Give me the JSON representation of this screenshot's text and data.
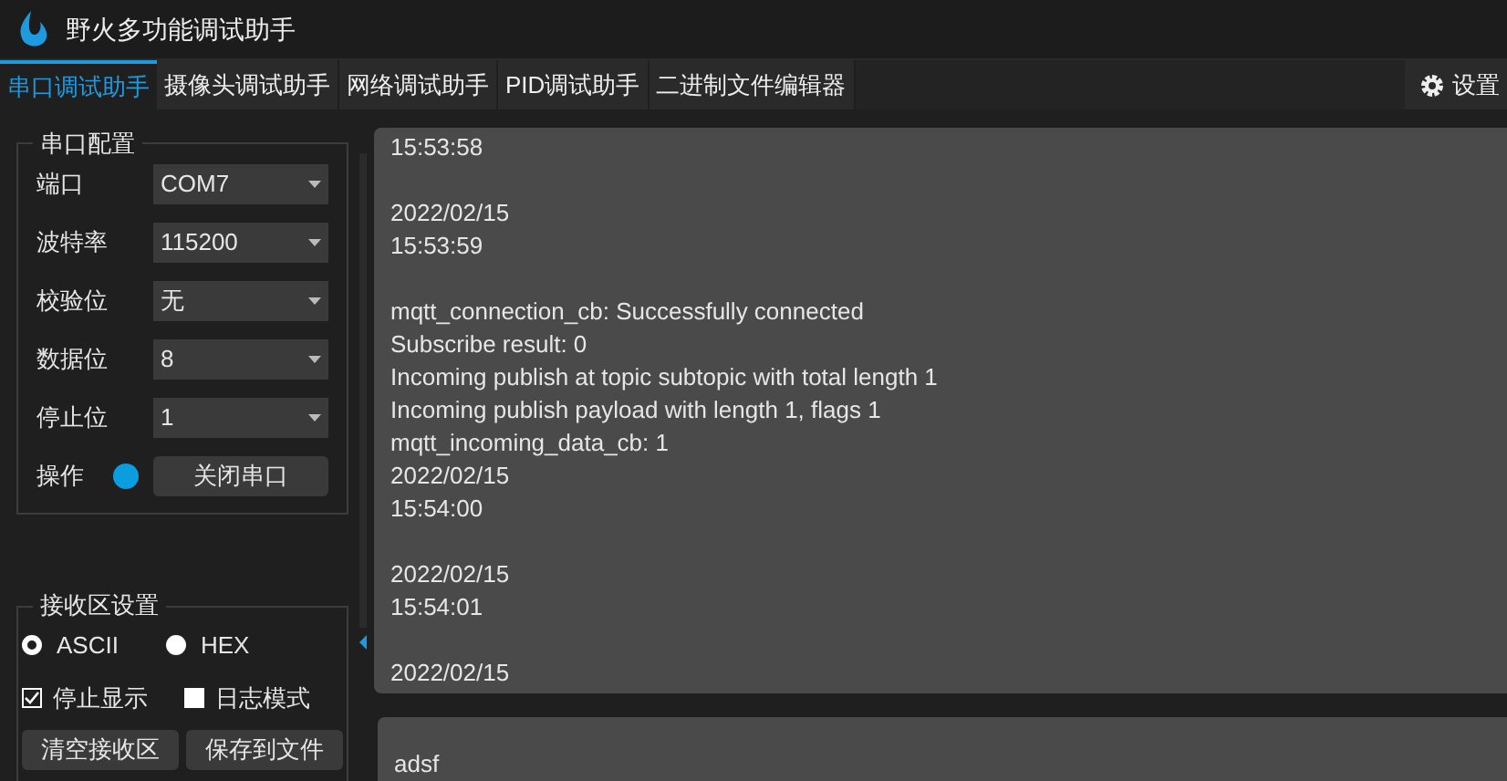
{
  "window": {
    "title": "野火多功能调试助手"
  },
  "tabs": [
    {
      "label": "串口调试助手",
      "selected": true
    },
    {
      "label": "摄像头调试助手",
      "selected": false
    },
    {
      "label": "网络调试助手",
      "selected": false
    },
    {
      "label": "PID调试助手",
      "selected": false
    },
    {
      "label": "二进制文件编辑器",
      "selected": false
    }
  ],
  "settings_button": {
    "label": "设置"
  },
  "serial_config": {
    "title": "串口配置",
    "fields": [
      {
        "label": "端口",
        "value": "COM7"
      },
      {
        "label": "波特率",
        "value": "115200"
      },
      {
        "label": "校验位",
        "value": "无"
      },
      {
        "label": "数据位",
        "value": "8"
      },
      {
        "label": "停止位",
        "value": "1"
      }
    ],
    "operation": {
      "label": "操作",
      "connected": true,
      "button": "关闭串口"
    }
  },
  "receive_settings": {
    "title": "接收区设置",
    "modes": [
      {
        "label": "ASCII",
        "selected": true
      },
      {
        "label": "HEX",
        "selected": false
      }
    ],
    "options": [
      {
        "label": "停止显示",
        "checked": true
      },
      {
        "label": "日志模式",
        "checked": false
      }
    ],
    "buttons": [
      "清空接收区",
      "保存到文件"
    ]
  },
  "receive_log": [
    [
      "15:53:58"
    ],
    [
      "2022/02/15",
      "15:53:59"
    ],
    [
      "mqtt_connection_cb: Successfully connected",
      "Subscribe result: 0",
      "Incoming publish at topic subtopic with total length 1",
      "Incoming publish payload with length 1, flags 1",
      "mqtt_incoming_data_cb: 1",
      "2022/02/15",
      "15:54:00"
    ],
    [
      "2022/02/15",
      "15:54:01"
    ],
    [
      "2022/02/15"
    ]
  ],
  "send_text": "adsf"
}
